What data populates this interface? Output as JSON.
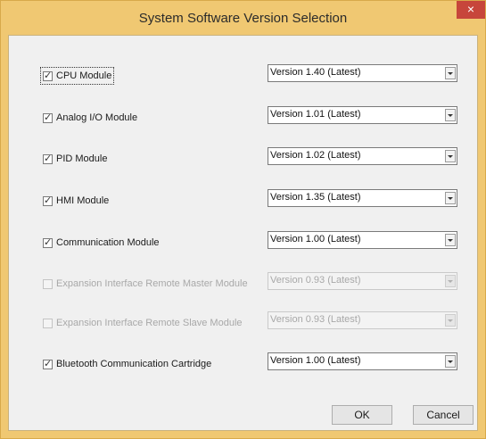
{
  "dialog": {
    "title": "System Software Version Selection",
    "close_glyph": "×"
  },
  "modules": [
    {
      "label": "CPU Module",
      "checked": true,
      "enabled": true,
      "version": "Version 1.40 (Latest)"
    },
    {
      "label": "Analog I/O Module",
      "checked": true,
      "enabled": true,
      "version": "Version 1.01 (Latest)"
    },
    {
      "label": "PID Module",
      "checked": true,
      "enabled": true,
      "version": "Version 1.02 (Latest)"
    },
    {
      "label": "HMI Module",
      "checked": true,
      "enabled": true,
      "version": "Version 1.35 (Latest)"
    },
    {
      "label": "Communication Module",
      "checked": true,
      "enabled": true,
      "version": "Version 1.00 (Latest)"
    },
    {
      "label": "Expansion Interface Remote Master Module",
      "checked": false,
      "enabled": false,
      "version": "Version 0.93 (Latest)"
    },
    {
      "label": "Expansion Interface Remote Slave Module",
      "checked": false,
      "enabled": false,
      "version": "Version 0.93 (Latest)"
    },
    {
      "label": "Bluetooth Communication Cartridge",
      "checked": true,
      "enabled": true,
      "version": "Version 1.00 (Latest)"
    }
  ],
  "buttons": {
    "ok": "OK",
    "cancel": "Cancel"
  }
}
